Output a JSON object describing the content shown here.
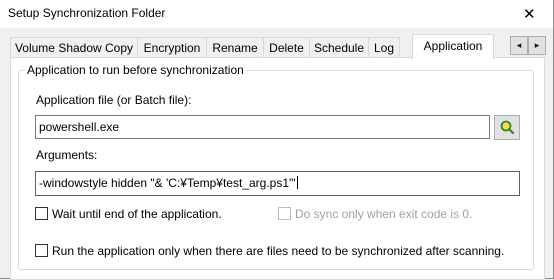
{
  "window": {
    "title": "Setup Synchronization Folder",
    "close_glyph": "✕"
  },
  "tabs": [
    {
      "label": "Volume Shadow Copy"
    },
    {
      "label": "Encryption"
    },
    {
      "label": "Rename"
    },
    {
      "label": "Delete"
    },
    {
      "label": "Schedule"
    },
    {
      "label": "Log"
    },
    {
      "label": "Application",
      "active": true
    }
  ],
  "tab_scroll": {
    "left_glyph": "◂",
    "right_glyph": "▸"
  },
  "group": {
    "title": "Application to run before synchronization",
    "app_file_label": "Application file (or Batch file):",
    "app_file_value": "powershell.exe",
    "browse_icon": "magnifier-icon",
    "arguments_label": "Arguments:",
    "arguments_value": "-windowstyle hidden \"& 'C:¥Temp¥test_arg.ps1'\"",
    "wait_label": "Wait until end of the application.",
    "wait_checked": false,
    "exit_code_label": "Do sync only when exit code is 0.",
    "exit_code_checked": false,
    "exit_code_enabled": false,
    "only_when_files_label": "Run the application only when there are files need to be synchronized after scanning.",
    "only_when_files_checked": false
  },
  "colors": {
    "focus_border": "#0078d7",
    "panel_bg": "#ffffff",
    "window_bg": "#f0f0f0"
  }
}
